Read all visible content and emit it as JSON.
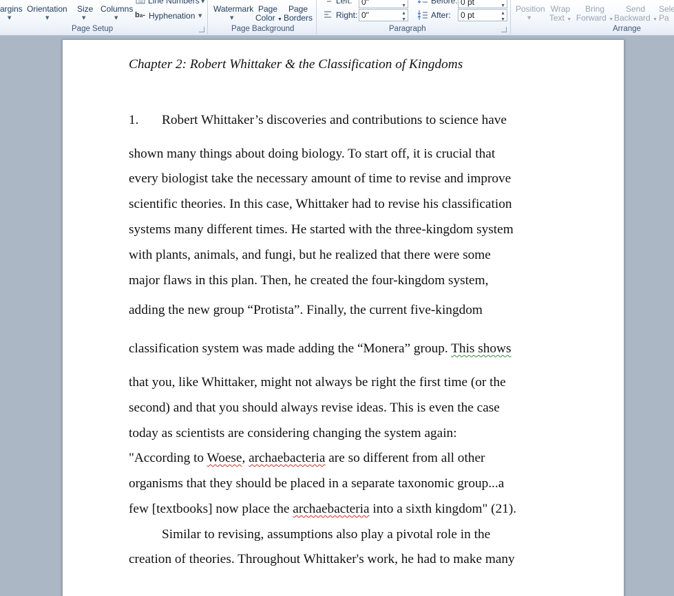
{
  "ribbon": {
    "page_setup": {
      "margins": "argins",
      "orientation": "Orientation",
      "size": "Size",
      "columns": "Columns",
      "line_numbers": "Line Numbers",
      "hyphenation": "Hyphenation",
      "label": "Page Setup"
    },
    "page_background": {
      "watermark": "Watermark",
      "page_color_1": "Page",
      "page_color_2": "Color",
      "page_borders_1": "Page",
      "page_borders_2": "Borders",
      "label": "Page Background"
    },
    "paragraph": {
      "left_label": "Left:",
      "left_value": "0\"",
      "right_label": "Right:",
      "right_value": "0\"",
      "before_label": "Before:",
      "before_value": "0 pt",
      "after_label": "After:",
      "after_value": "0 pt",
      "label": "Paragraph"
    },
    "arrange": {
      "position": "Position",
      "wrap_1": "Wrap",
      "wrap_2": "Text",
      "bring_1": "Bring",
      "bring_2": "Forward",
      "send_1": "Send",
      "send_2": "Backward",
      "select_1": "Sele",
      "select_2": "Pa",
      "label": "Arrange"
    }
  },
  "document": {
    "title": "Chapter 2: Robert Whittaker & the Classification of Kingdoms",
    "number": "1.",
    "l1": "Robert Whittaker’s discoveries and contributions to science have",
    "l2": "shown many things about doing biology. To start off, it is crucial that",
    "l3": "every biologist take the necessary amount of time to revise and improve",
    "l4": "scientific theories. In this case, Whittaker had to revise his classification",
    "l5": "systems many different times. He started with the three-kingdom system",
    "l6": "with plants, animals, and fungi, but he realized that there were some",
    "l7": "major flaws in this plan. Then, he created the four-kingdom system,",
    "l8": "adding the new group “Protista”. Finally, the current five-kingdom",
    "l9a": "classification system was made adding the “Monera” group. ",
    "l9b": "This shows",
    "l10": "that you, like Whittaker, might not always be right the first time (or the",
    "l11": "second) and that you should always revise ideas. This is even the case",
    "l12": "today as scientists are considering changing the system again:",
    "l13a": "\"According to ",
    "l13b": "Woese",
    "l13c": ", ",
    "l13d": "archaebacteria",
    "l13e": " are so different from all other",
    "l14": "organisms that they should be placed in a separate taxonomic group...a",
    "l15a": "few [textbooks] now place the ",
    "l15b": "archaebacteria",
    "l15c": " into a sixth kingdom\" (21).",
    "l16": "Similar to revising, assumptions also play a pivotal role in the",
    "l17": "creation of theories. Throughout Whittaker's work, he had to make many"
  }
}
